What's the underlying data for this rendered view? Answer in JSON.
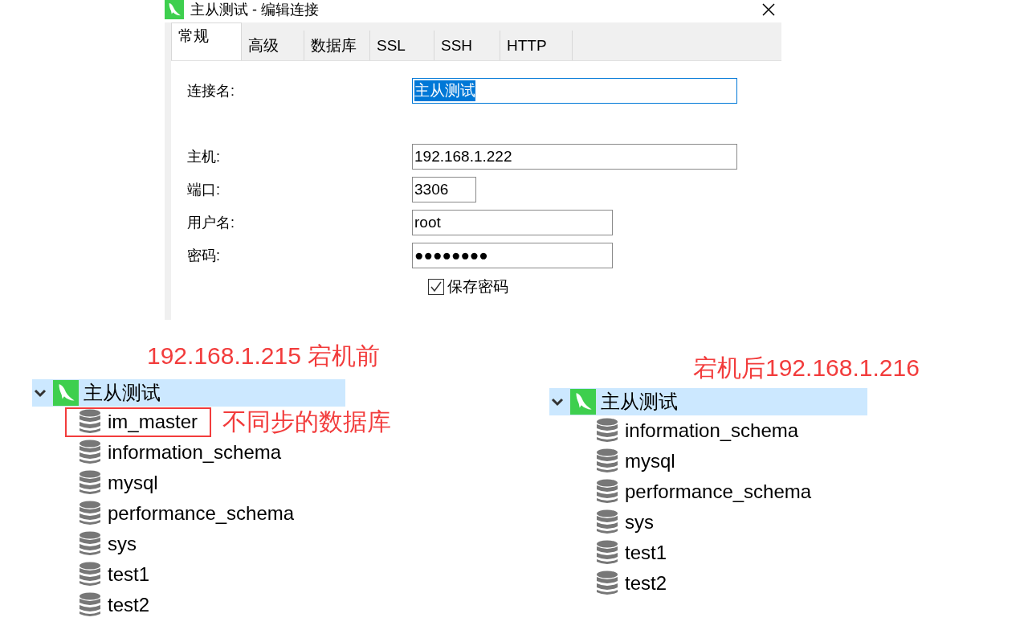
{
  "dialog": {
    "title": "主从测试 - 编辑连接",
    "tabs": [
      {
        "label": "常规",
        "selected": true
      },
      {
        "label": "高级",
        "selected": false
      },
      {
        "label": "数据库",
        "selected": false
      },
      {
        "label": "SSL",
        "selected": false
      },
      {
        "label": "SSH",
        "selected": false
      },
      {
        "label": "HTTP",
        "selected": false
      }
    ],
    "fields": [
      {
        "label": "连接名:",
        "value": "主从测试",
        "highlighted": true
      },
      {
        "label": "主机:",
        "value": "192.168.1.222",
        "highlighted": false
      },
      {
        "label": "端口:",
        "value": "3306",
        "highlighted": false
      },
      {
        "label": "用户名:",
        "value": "root",
        "highlighted": false
      },
      {
        "label": "密码:",
        "value": "●●●●●●●●",
        "highlighted": false
      }
    ],
    "save_password": {
      "label": "保存密码",
      "checked": true
    }
  },
  "trees": [
    {
      "annotation": "192.168.1.215 宕机前",
      "connection": {
        "label": "主从测试",
        "expanded": true,
        "selected": true,
        "children": [
          {
            "label": "im_master",
            "flagged": true,
            "note": "不同步的数据库"
          },
          {
            "label": "information_schema",
            "flagged": false
          },
          {
            "label": "mysql",
            "flagged": false
          },
          {
            "label": "performance_schema",
            "flagged": false
          },
          {
            "label": "sys",
            "flagged": false
          },
          {
            "label": "test1",
            "flagged": false
          },
          {
            "label": "test2",
            "flagged": false
          }
        ]
      }
    },
    {
      "annotation": "宕机后192.168.1.216",
      "connection": {
        "label": "主从测试",
        "expanded": true,
        "selected": true,
        "children": [
          {
            "label": "information_schema",
            "flagged": false
          },
          {
            "label": "mysql",
            "flagged": false
          },
          {
            "label": "performance_schema",
            "flagged": false
          },
          {
            "label": "sys",
            "flagged": false
          },
          {
            "label": "test1",
            "flagged": false
          },
          {
            "label": "test2",
            "flagged": false
          }
        ]
      }
    }
  ]
}
